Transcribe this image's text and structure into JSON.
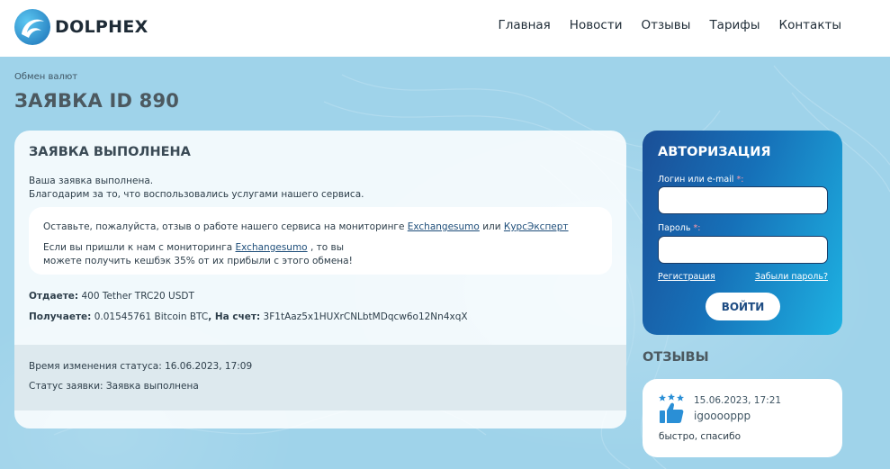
{
  "header": {
    "brand": "DOLPHEX",
    "nav": [
      "Главная",
      "Новости",
      "Отзывы",
      "Тарифы",
      "Контакты"
    ]
  },
  "breadcrumb": "Обмен валют",
  "page_title": "ЗАЯВКА ID 890",
  "order": {
    "heading": "ЗАЯВКА ВЫПОЛНЕНА",
    "line1": "Ваша заявка выполнена.",
    "line2": "Благодарим за то, что воспользовались услугами нашего сервиса.",
    "review": {
      "text1": "Оставьте, пожалуйста, отзыв о работе нашего сервиса на мониторинге",
      "link1": "Exchangesumo",
      "or": "или",
      "link2": "КурсЭксперт",
      "text2": "Если вы пришли к нам с мониторинга",
      "link3": "Exchangesumo",
      "text3": ", то вы",
      "text4": "можете получить кешбэк 35% от их прибыли с этого обмена!"
    },
    "give_label": "Отдаете:",
    "give_value": "400 Tether TRC20 USDT",
    "get_label": "Получаете:",
    "get_value": "0.01545761 Bitcoin BTC",
    "account_label": ", На счет:",
    "account_value": "3F1tAaz5x1HUXrCNLbtMDqcw6o12Nn4xqX",
    "status_time": "Время изменения статуса: 16.06.2023, 17:09",
    "status": "Статус заявки: Заявка выполнена"
  },
  "auth": {
    "title": "АВТОРИЗАЦИЯ",
    "login_label": "Логин или e-mail",
    "password_label": "Пароль",
    "required_mark": "*:",
    "register": "Регистрация",
    "forgot": "Забыли пароль?",
    "submit": "ВОЙТИ"
  },
  "reviews": {
    "title": "ОТЗЫВЫ",
    "items": [
      {
        "date": "15.06.2023, 17:21",
        "user": "igooooppp",
        "text": "быстро, спасибо"
      }
    ]
  },
  "colors": {
    "background": "#9fd3ea",
    "auth_gradient_start": "#1b4f97",
    "auth_gradient_end": "#1eb2e2"
  },
  "icons": [
    "dolphin-logo-icon",
    "thumbs-up-stars-icon"
  ]
}
